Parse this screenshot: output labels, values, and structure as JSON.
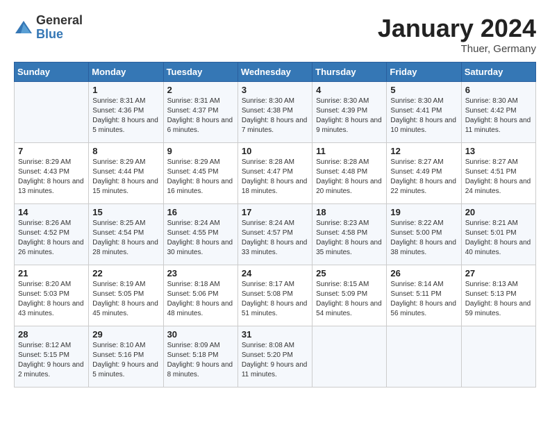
{
  "header": {
    "logo_general": "General",
    "logo_blue": "Blue",
    "month_title": "January 2024",
    "location": "Thuer, Germany"
  },
  "weekdays": [
    "Sunday",
    "Monday",
    "Tuesday",
    "Wednesday",
    "Thursday",
    "Friday",
    "Saturday"
  ],
  "weeks": [
    [
      {
        "day": "",
        "sunrise": "",
        "sunset": "",
        "daylight": ""
      },
      {
        "day": "1",
        "sunrise": "Sunrise: 8:31 AM",
        "sunset": "Sunset: 4:36 PM",
        "daylight": "Daylight: 8 hours and 5 minutes."
      },
      {
        "day": "2",
        "sunrise": "Sunrise: 8:31 AM",
        "sunset": "Sunset: 4:37 PM",
        "daylight": "Daylight: 8 hours and 6 minutes."
      },
      {
        "day": "3",
        "sunrise": "Sunrise: 8:30 AM",
        "sunset": "Sunset: 4:38 PM",
        "daylight": "Daylight: 8 hours and 7 minutes."
      },
      {
        "day": "4",
        "sunrise": "Sunrise: 8:30 AM",
        "sunset": "Sunset: 4:39 PM",
        "daylight": "Daylight: 8 hours and 9 minutes."
      },
      {
        "day": "5",
        "sunrise": "Sunrise: 8:30 AM",
        "sunset": "Sunset: 4:41 PM",
        "daylight": "Daylight: 8 hours and 10 minutes."
      },
      {
        "day": "6",
        "sunrise": "Sunrise: 8:30 AM",
        "sunset": "Sunset: 4:42 PM",
        "daylight": "Daylight: 8 hours and 11 minutes."
      }
    ],
    [
      {
        "day": "7",
        "sunrise": "Sunrise: 8:29 AM",
        "sunset": "Sunset: 4:43 PM",
        "daylight": "Daylight: 8 hours and 13 minutes."
      },
      {
        "day": "8",
        "sunrise": "Sunrise: 8:29 AM",
        "sunset": "Sunset: 4:44 PM",
        "daylight": "Daylight: 8 hours and 15 minutes."
      },
      {
        "day": "9",
        "sunrise": "Sunrise: 8:29 AM",
        "sunset": "Sunset: 4:45 PM",
        "daylight": "Daylight: 8 hours and 16 minutes."
      },
      {
        "day": "10",
        "sunrise": "Sunrise: 8:28 AM",
        "sunset": "Sunset: 4:47 PM",
        "daylight": "Daylight: 8 hours and 18 minutes."
      },
      {
        "day": "11",
        "sunrise": "Sunrise: 8:28 AM",
        "sunset": "Sunset: 4:48 PM",
        "daylight": "Daylight: 8 hours and 20 minutes."
      },
      {
        "day": "12",
        "sunrise": "Sunrise: 8:27 AM",
        "sunset": "Sunset: 4:49 PM",
        "daylight": "Daylight: 8 hours and 22 minutes."
      },
      {
        "day": "13",
        "sunrise": "Sunrise: 8:27 AM",
        "sunset": "Sunset: 4:51 PM",
        "daylight": "Daylight: 8 hours and 24 minutes."
      }
    ],
    [
      {
        "day": "14",
        "sunrise": "Sunrise: 8:26 AM",
        "sunset": "Sunset: 4:52 PM",
        "daylight": "Daylight: 8 hours and 26 minutes."
      },
      {
        "day": "15",
        "sunrise": "Sunrise: 8:25 AM",
        "sunset": "Sunset: 4:54 PM",
        "daylight": "Daylight: 8 hours and 28 minutes."
      },
      {
        "day": "16",
        "sunrise": "Sunrise: 8:24 AM",
        "sunset": "Sunset: 4:55 PM",
        "daylight": "Daylight: 8 hours and 30 minutes."
      },
      {
        "day": "17",
        "sunrise": "Sunrise: 8:24 AM",
        "sunset": "Sunset: 4:57 PM",
        "daylight": "Daylight: 8 hours and 33 minutes."
      },
      {
        "day": "18",
        "sunrise": "Sunrise: 8:23 AM",
        "sunset": "Sunset: 4:58 PM",
        "daylight": "Daylight: 8 hours and 35 minutes."
      },
      {
        "day": "19",
        "sunrise": "Sunrise: 8:22 AM",
        "sunset": "Sunset: 5:00 PM",
        "daylight": "Daylight: 8 hours and 38 minutes."
      },
      {
        "day": "20",
        "sunrise": "Sunrise: 8:21 AM",
        "sunset": "Sunset: 5:01 PM",
        "daylight": "Daylight: 8 hours and 40 minutes."
      }
    ],
    [
      {
        "day": "21",
        "sunrise": "Sunrise: 8:20 AM",
        "sunset": "Sunset: 5:03 PM",
        "daylight": "Daylight: 8 hours and 43 minutes."
      },
      {
        "day": "22",
        "sunrise": "Sunrise: 8:19 AM",
        "sunset": "Sunset: 5:05 PM",
        "daylight": "Daylight: 8 hours and 45 minutes."
      },
      {
        "day": "23",
        "sunrise": "Sunrise: 8:18 AM",
        "sunset": "Sunset: 5:06 PM",
        "daylight": "Daylight: 8 hours and 48 minutes."
      },
      {
        "day": "24",
        "sunrise": "Sunrise: 8:17 AM",
        "sunset": "Sunset: 5:08 PM",
        "daylight": "Daylight: 8 hours and 51 minutes."
      },
      {
        "day": "25",
        "sunrise": "Sunrise: 8:15 AM",
        "sunset": "Sunset: 5:09 PM",
        "daylight": "Daylight: 8 hours and 54 minutes."
      },
      {
        "day": "26",
        "sunrise": "Sunrise: 8:14 AM",
        "sunset": "Sunset: 5:11 PM",
        "daylight": "Daylight: 8 hours and 56 minutes."
      },
      {
        "day": "27",
        "sunrise": "Sunrise: 8:13 AM",
        "sunset": "Sunset: 5:13 PM",
        "daylight": "Daylight: 8 hours and 59 minutes."
      }
    ],
    [
      {
        "day": "28",
        "sunrise": "Sunrise: 8:12 AM",
        "sunset": "Sunset: 5:15 PM",
        "daylight": "Daylight: 9 hours and 2 minutes."
      },
      {
        "day": "29",
        "sunrise": "Sunrise: 8:10 AM",
        "sunset": "Sunset: 5:16 PM",
        "daylight": "Daylight: 9 hours and 5 minutes."
      },
      {
        "day": "30",
        "sunrise": "Sunrise: 8:09 AM",
        "sunset": "Sunset: 5:18 PM",
        "daylight": "Daylight: 9 hours and 8 minutes."
      },
      {
        "day": "31",
        "sunrise": "Sunrise: 8:08 AM",
        "sunset": "Sunset: 5:20 PM",
        "daylight": "Daylight: 9 hours and 11 minutes."
      },
      {
        "day": "",
        "sunrise": "",
        "sunset": "",
        "daylight": ""
      },
      {
        "day": "",
        "sunrise": "",
        "sunset": "",
        "daylight": ""
      },
      {
        "day": "",
        "sunrise": "",
        "sunset": "",
        "daylight": ""
      }
    ]
  ]
}
